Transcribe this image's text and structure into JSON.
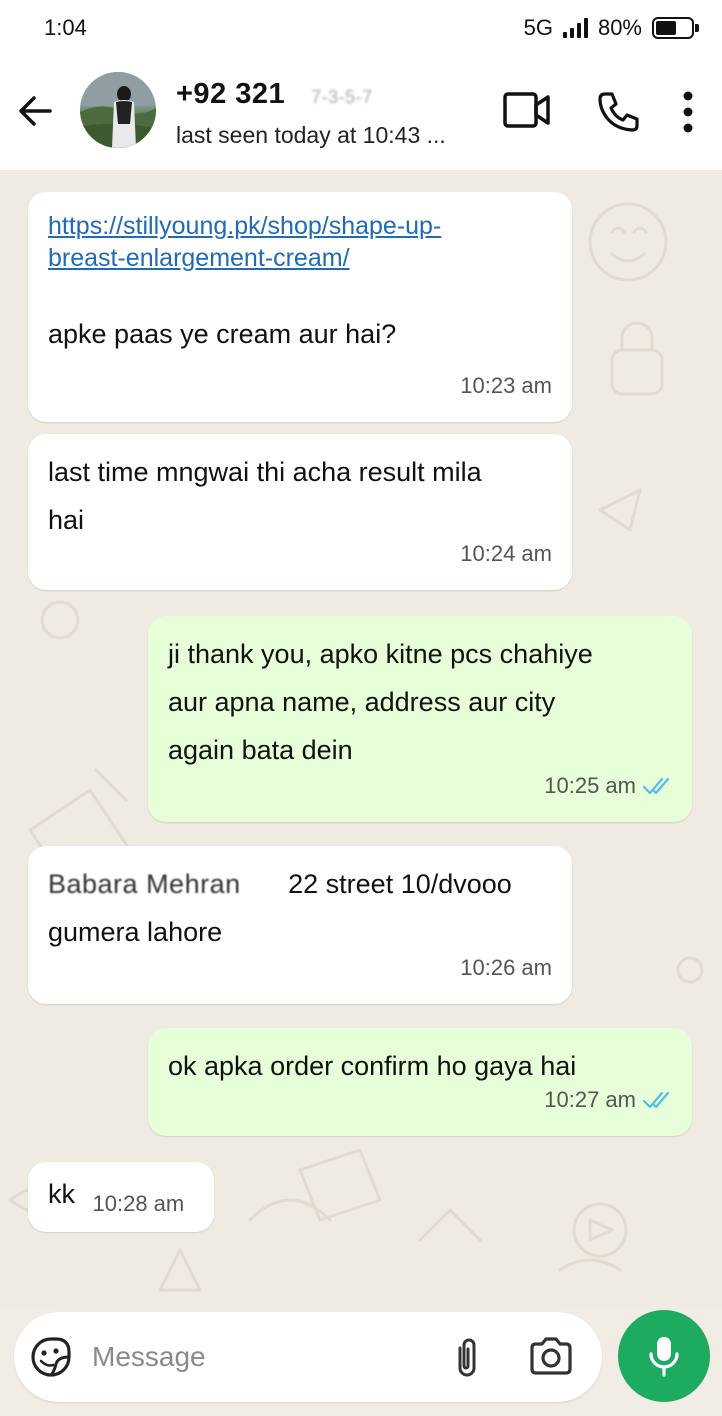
{
  "status_bar": {
    "time": "1:04",
    "network": "5G",
    "battery": "80%"
  },
  "header": {
    "contact_number": "+92 321",
    "contact_number_hidden": "7-3-5-7",
    "last_seen": "last seen today at 10:43 ..."
  },
  "messages": [
    {
      "direction": "in",
      "link": "https://stillyoung.pk/shop/shape-up-breast-enlargement-cream/",
      "link_line1": "https://stillyoung.pk/shop/shape-up-",
      "link_line2": "breast-enlargement-cream/",
      "text": "apke paas ye cream aur hai?",
      "time": "10:23 am"
    },
    {
      "direction": "in",
      "line1": "last time mngwai thi acha result mila",
      "line2": "hai",
      "time": "10:24 am"
    },
    {
      "direction": "out",
      "line1": "ji thank you, apko kitne pcs chahiye",
      "line2": "aur apna name, address aur city",
      "line3": "again bata dein",
      "time": "10:25 am",
      "status": "read"
    },
    {
      "direction": "in",
      "line1_blur": "Babara Mehran",
      "line1_tail": "22 street 10/dvooo",
      "line2": "gumera lahore",
      "time": "10:26 am"
    },
    {
      "direction": "out",
      "text": "ok apka order confirm ho gaya hai",
      "time": "10:27 am",
      "status": "read"
    },
    {
      "direction": "in",
      "text": "kk",
      "time": "10:28 am"
    }
  ],
  "composer": {
    "placeholder": "Message"
  },
  "colors": {
    "outgoing_bubble": "#e7ffd9",
    "incoming_bubble": "#ffffff",
    "chat_background": "#efeae2",
    "mic_button": "#1daa61",
    "read_ticks": "#53bdeb",
    "link": "#1f6bb5"
  },
  "icons": [
    "back-arrow-icon",
    "video-call-icon",
    "phone-icon",
    "more-options-icon",
    "sticker-icon",
    "paperclip-icon",
    "camera-icon",
    "mic-icon",
    "double-check-icon"
  ]
}
